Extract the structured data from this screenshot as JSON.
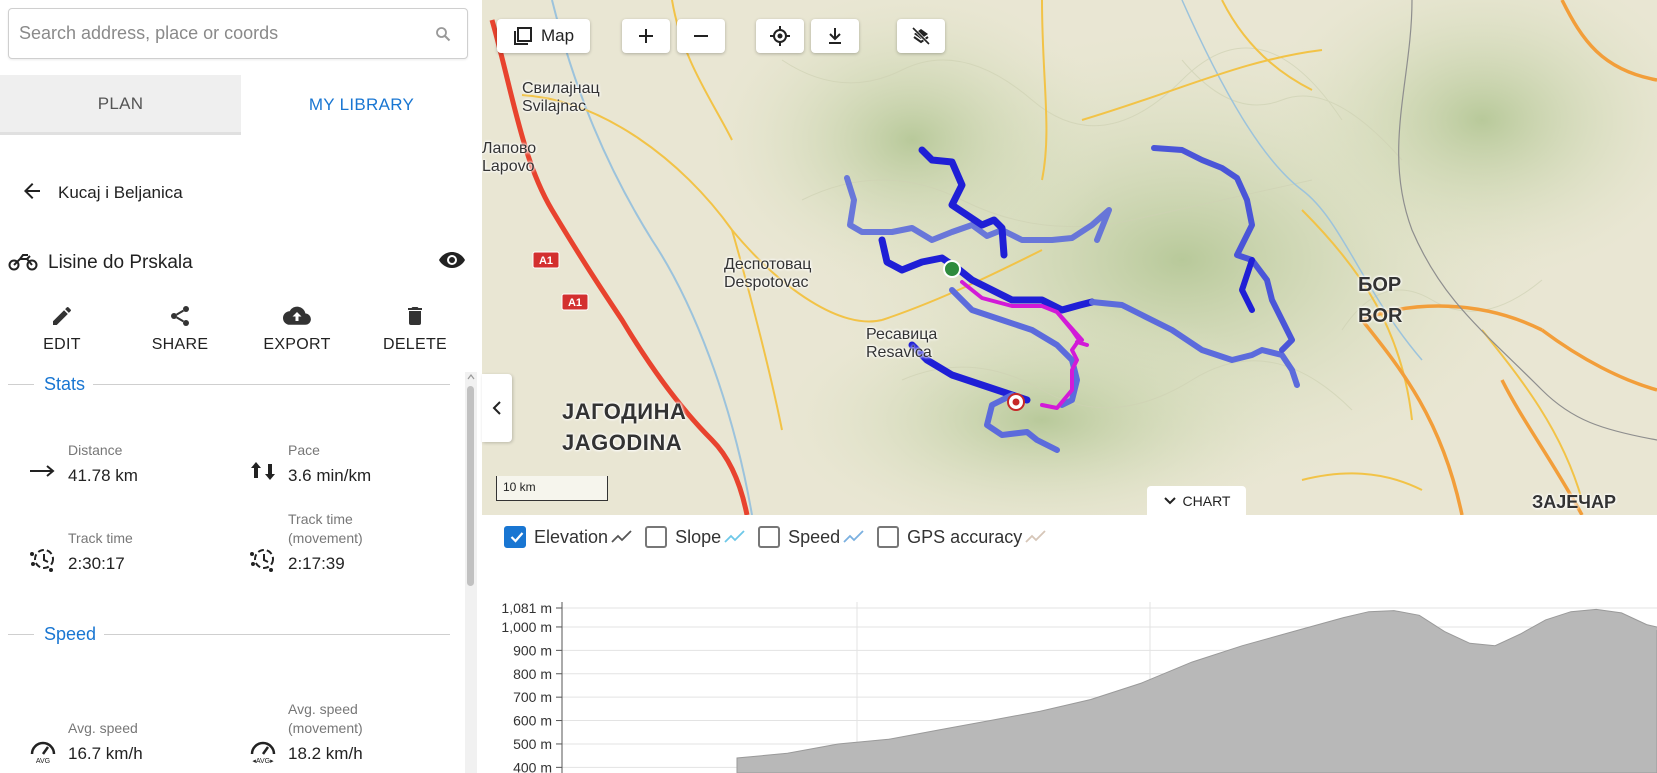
{
  "search": {
    "placeholder": "Search address, place or coords"
  },
  "tabs": [
    {
      "label": "PLAN"
    },
    {
      "label": "MY LIBRARY"
    }
  ],
  "folder": {
    "title": "Kucaj i Beljanica"
  },
  "track": {
    "name": "Lisine do Prskala"
  },
  "actions": [
    {
      "label": "EDIT",
      "icon": "pencil-icon"
    },
    {
      "label": "SHARE",
      "icon": "share-icon"
    },
    {
      "label": "EXPORT",
      "icon": "cloud-upload-icon"
    },
    {
      "label": "DELETE",
      "icon": "trash-icon"
    }
  ],
  "stats": {
    "header": "Stats",
    "distance": {
      "label": "Distance",
      "value": "41.78 km"
    },
    "pace": {
      "label": "Pace",
      "value": "3.6 min/km"
    },
    "track_time": {
      "label": "Track time",
      "value": "2:30:17"
    },
    "track_time_movement": {
      "label": "Track time\n(movement)",
      "label_l1": "Track time",
      "label_l2": "(movement)",
      "value": "2:17:39"
    }
  },
  "speed": {
    "header": "Speed",
    "avg": {
      "label": "Avg. speed",
      "value": "16.7 km/h"
    },
    "avg_movement": {
      "label_l1": "Avg. speed",
      "label_l2": "(movement)",
      "value": "18.2 km/h"
    }
  },
  "map": {
    "layer_button": "Map",
    "scale_label": "10 km",
    "chart_toggle": "CHART",
    "places": {
      "svilajnac_cyr": "Свилајнац",
      "svilajnac": "Svilajnac",
      "lapovo_cyr": "Лапово",
      "lapovo": "Lapovo",
      "despotovac_cyr": "Деспотовац",
      "despotovac": "Despotovac",
      "resavica_cyr": "Ресавица",
      "resavica": "Resavica",
      "jagodina_cyr": "ЈАГОДИНА",
      "jagodina": "JAGODINA",
      "bor_cyr": "БОР",
      "bor": "BOR",
      "zajecar_cyr": "ЗАЈЕЧАР",
      "a1": "A1"
    },
    "colors": {
      "track": "#1f1fd6",
      "track_faded": "#5c6bdc",
      "highlight": "#d21ad8",
      "start": "#2e8b3d",
      "end": "#c62828"
    }
  },
  "chart": {
    "legend": [
      {
        "label": "Elevation",
        "checked": true,
        "color": "#555555"
      },
      {
        "label": "Slope",
        "checked": false,
        "color": "#6ec8e8"
      },
      {
        "label": "Speed",
        "checked": false,
        "color": "#7ab0e0"
      },
      {
        "label": "GPS accuracy",
        "checked": false,
        "color": "#d6c6b8"
      }
    ]
  },
  "chart_data": {
    "type": "area",
    "title": "",
    "xlabel": "",
    "ylabel": "",
    "yticks": [
      "1,081 m",
      "1,000 m",
      "900 m",
      "800 m",
      "700 m",
      "600 m",
      "500 m",
      "400 m"
    ],
    "ylim": [
      400,
      1081
    ],
    "x": [
      0,
      2,
      4,
      6,
      8,
      10,
      12,
      14,
      16,
      18,
      20,
      22,
      24,
      25,
      26,
      27,
      28,
      29,
      30,
      31,
      32,
      33,
      34,
      35,
      36,
      37
    ],
    "values": [
      440,
      460,
      500,
      520,
      560,
      600,
      640,
      690,
      760,
      850,
      920,
      980,
      1040,
      1065,
      1070,
      1050,
      980,
      930,
      920,
      970,
      1030,
      1065,
      1075,
      1060,
      1010,
      985
    ],
    "grid": true
  }
}
